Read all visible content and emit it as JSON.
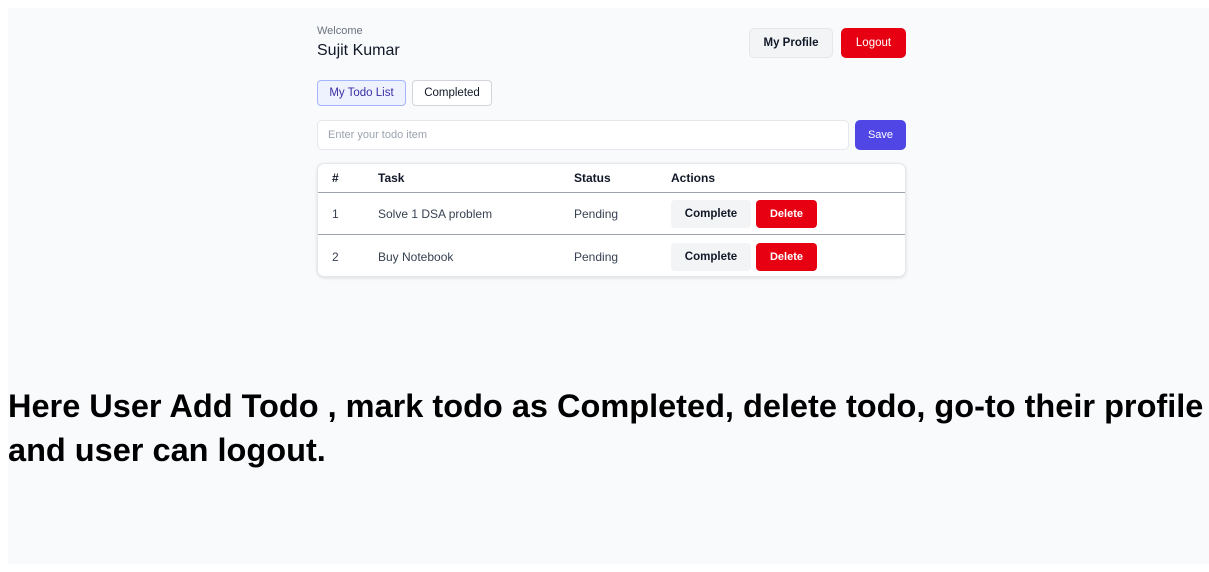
{
  "header": {
    "welcome_label": "Welcome",
    "user_name": "Sujit Kumar",
    "profile_button": "My Profile",
    "logout_button": "Logout"
  },
  "tabs": [
    {
      "label": "My Todo List",
      "active": true
    },
    {
      "label": "Completed",
      "active": false
    }
  ],
  "todo_form": {
    "placeholder": "Enter your todo item",
    "value": "",
    "save_button": "Save"
  },
  "table": {
    "columns": [
      "#",
      "Task",
      "Status",
      "Actions"
    ],
    "rows": [
      {
        "num": "1",
        "task": "Solve 1 DSA problem",
        "status": "Pending",
        "complete_label": "Complete",
        "delete_label": "Delete"
      },
      {
        "num": "2",
        "task": "Buy Notebook",
        "status": "Pending",
        "complete_label": "Complete",
        "delete_label": "Delete"
      }
    ]
  },
  "caption": "Here User Add Todo , mark todo as Completed, delete todo, go-to their profile and user can logout.",
  "colors": {
    "accent": "#4f46e5",
    "danger": "#e60012",
    "background": "#f8fafc"
  }
}
